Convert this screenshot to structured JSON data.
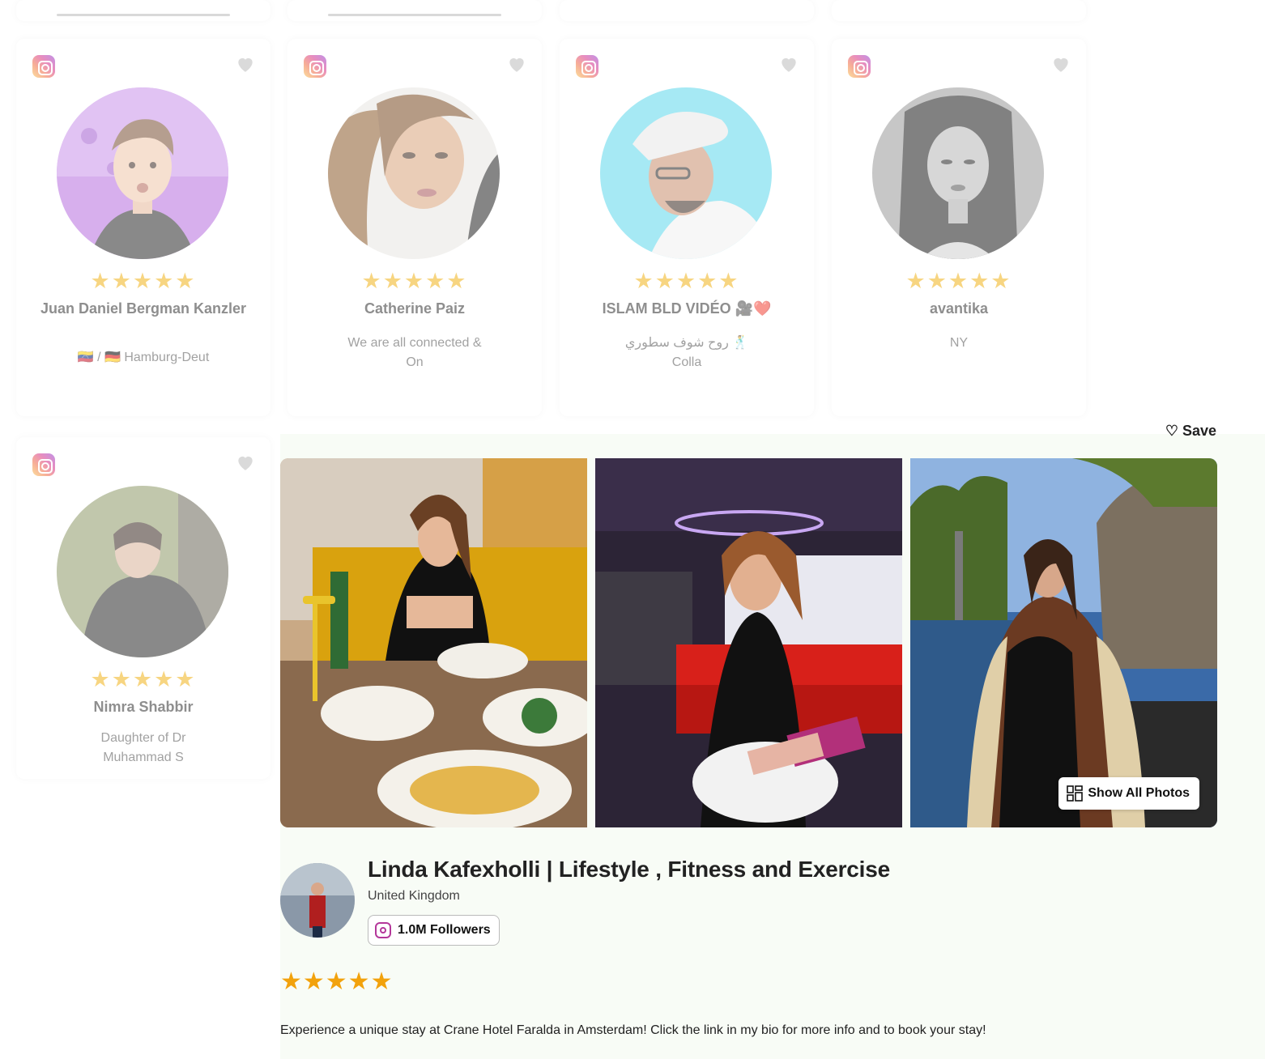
{
  "colors": {
    "accent_star": "#f2a20c",
    "bio_bg": "#e1efdc",
    "panel_bg": "#f8fcf6"
  },
  "cards": [
    {
      "name": "Juan Daniel Bergman Kanzler",
      "bio": "🇻🇪 / 🇩🇪 Hamburg-Deut",
      "stars": "★★★★★"
    },
    {
      "name": "Catherine Paiz",
      "bio": "We are all connected & On",
      "stars": "★★★★★"
    },
    {
      "name": "ISLAM BLD VIDÉO 🎥❤️",
      "bio": "روح شوف سطوري 🕺 Colla",
      "stars": "★★★★★"
    },
    {
      "name": "avantika",
      "bio": "NY",
      "stars": "★★★★★"
    },
    {
      "name": "Nimra Shabbir",
      "bio": "Daughter of Dr Muhammad S",
      "stars": "★★★★★"
    }
  ],
  "detail": {
    "save_label": "♡ Save",
    "show_all_label": "Show All Photos",
    "title": "Linda Kafexholli | Lifestyle , Fitness and Exercise",
    "country": "United Kingdom",
    "followers": "1.0M Followers",
    "rating": "★★★★★",
    "description": "Experience a unique stay at Crane Hotel Faralda in Amsterdam! Click the link in my bio for more info and to book your stay!"
  },
  "icons": [
    "instagram-icon",
    "heart-icon",
    "grid-icon"
  ]
}
